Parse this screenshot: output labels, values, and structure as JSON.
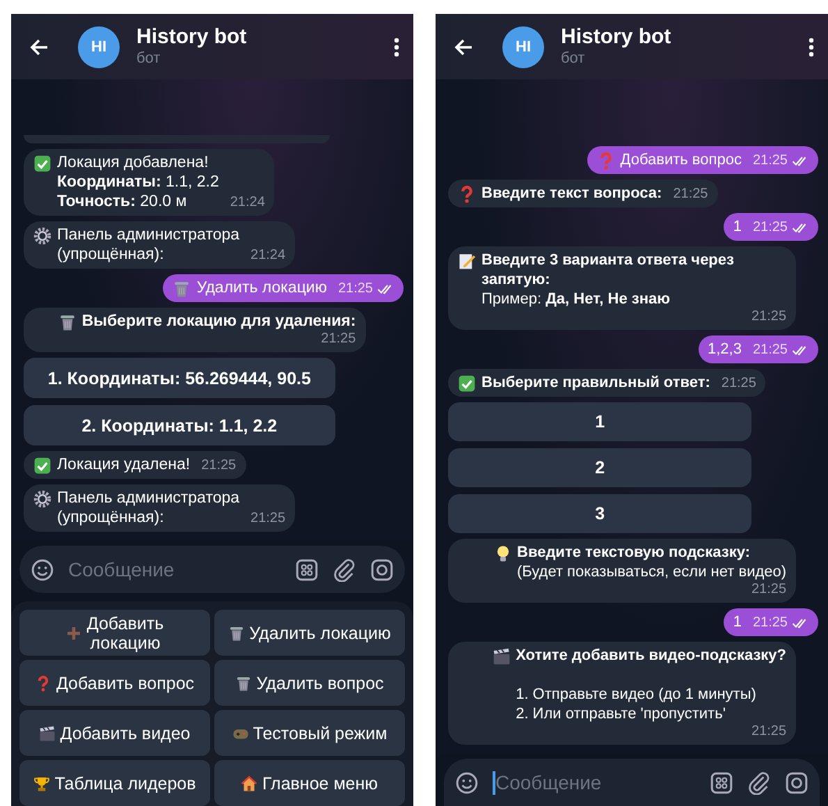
{
  "screens": [
    {
      "header": {
        "avatar": "HI",
        "title": "History bot",
        "subtitle": "бот"
      },
      "messages": [
        {
          "kind": "edge"
        },
        {
          "kind": "incoming",
          "icon": {
            "kind": "check"
          },
          "text": "Локация добавлена!\n**Координаты:** 1.1, 2.2\n**Точность:** 20.0 м",
          "time": "21:24"
        },
        {
          "kind": "incoming",
          "icon": {
            "kind": "gear"
          },
          "text": "Панель администратора\n(упрощённая):",
          "time": "21:24"
        },
        {
          "kind": "outgoing",
          "icon": {
            "kind": "trash"
          },
          "text": "Удалить локацию",
          "time": "21:25",
          "read": true
        },
        {
          "kind": "incoming",
          "icon": {
            "kind": "trash"
          },
          "text": "**Выберите локацию для удаления:**",
          "time": "21:25"
        },
        {
          "kind": "buttons",
          "buttons": [
            "1. Координаты: 56.269444, 90.5",
            "2. Координаты: 1.1, 2.2"
          ]
        },
        {
          "kind": "incoming",
          "icon": {
            "kind": "check"
          },
          "text": "Локация удалена!",
          "time": "21:25"
        },
        {
          "kind": "incoming",
          "icon": {
            "kind": "gear"
          },
          "text": "Панель администратора\n(упрощённая):",
          "time": "21:25"
        }
      ],
      "composer": {
        "placeholder": "Сообщение",
        "focused": false
      },
      "keyboard": [
        {
          "kind": "plus",
          "label": "Добавить\nлокацию"
        },
        {
          "kind": "trash",
          "label": "Удалить локацию"
        },
        {
          "kind": "question",
          "label": "Добавить вопрос"
        },
        {
          "kind": "trash",
          "label": "Удалить вопрос"
        },
        {
          "kind": "clapper",
          "label": "Добавить видео"
        },
        {
          "kind": "joystick",
          "label": "Тестовый режим"
        },
        {
          "kind": "trophy",
          "label": "Таблица лидеров"
        },
        {
          "kind": "house",
          "label": "Главное меню"
        }
      ]
    },
    {
      "header": {
        "avatar": "HI",
        "title": "History bot",
        "subtitle": "бот"
      },
      "messages": [
        {
          "kind": "outgoing",
          "icon": {
            "kind": "question"
          },
          "text": "Добавить вопрос",
          "time": "21:25",
          "read": true
        },
        {
          "kind": "incoming",
          "icon": {
            "kind": "question"
          },
          "text": "**Введите текст вопроса:**",
          "time": "21:25"
        },
        {
          "kind": "outgoing",
          "text": "1",
          "time": "21:25",
          "read": true
        },
        {
          "kind": "incoming",
          "icon": {
            "kind": "memo"
          },
          "text": "**Введите 3 варианта ответа через запятую:**\nПример: **Да, Нет, Не знаю**",
          "time": "21:25"
        },
        {
          "kind": "outgoing",
          "text": "1,2,3",
          "time": "21:25",
          "read": true
        },
        {
          "kind": "incoming",
          "icon": {
            "kind": "check"
          },
          "text": "**Выберите правильный ответ:**",
          "time": "21:25"
        },
        {
          "kind": "buttons",
          "buttons": [
            "1",
            "2",
            "3"
          ]
        },
        {
          "kind": "incoming",
          "icon": {
            "kind": "bulb"
          },
          "text": "**Введите текстовую подсказку:**\n(Будет показываться, если нет видео)",
          "time": "21:25"
        },
        {
          "kind": "outgoing",
          "text": "1",
          "time": "21:25",
          "read": true
        },
        {
          "kind": "incoming",
          "icon": {
            "kind": "clapper"
          },
          "text": "**Хотите добавить видео-подсказку?**\n\n1. Отправьте видео (до 1 минуты)\n2. Или отправьте 'пропустить'",
          "time": "21:25"
        }
      ],
      "composer": {
        "placeholder": "Сообщение",
        "focused": true
      }
    }
  ]
}
